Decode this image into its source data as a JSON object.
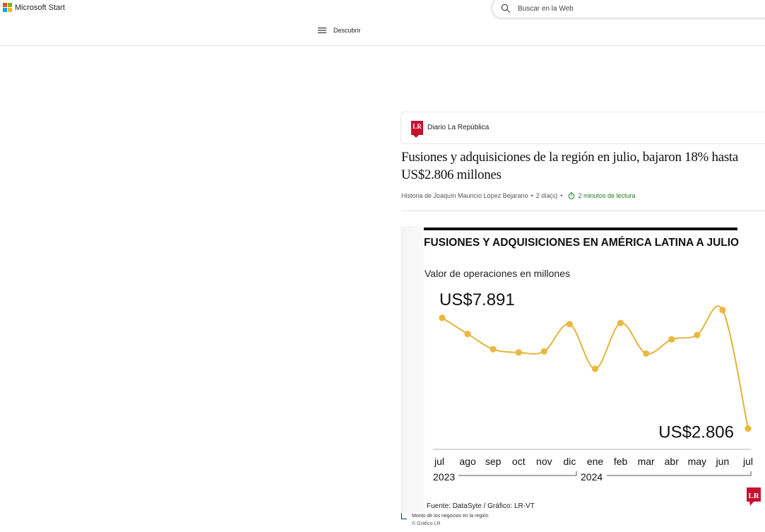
{
  "header": {
    "brand": "Microsoft Start",
    "search_placeholder": "Buscar en la Web",
    "nav_label": "Descubrir"
  },
  "article": {
    "source": "Diario La República",
    "source_logo_text": "LR",
    "title": "Fusiones y adquisiciones de la región en julio, bajaron 18% hasta US$2.806 millones",
    "byline": "Historia de Joaquín Mauricio López Bejarano",
    "age": "2 día(s)",
    "separator": "•",
    "read_time": "2 minutos de lectura",
    "figure_caption": "Monto de los negocios en la región",
    "figure_copyright": "© Gráfico LR"
  },
  "colors": {
    "line": "#e3b33a",
    "point": "#e8b840",
    "brand_red": "#c8102e",
    "read_green": "#1f7a1f"
  },
  "chart_data": {
    "type": "line",
    "title": "FUSIONES Y ADQUISICIONES EN AMÉRICA LATINA A JULIO",
    "subtitle": "Valor de operaciones en millones",
    "categories": [
      "jul",
      "ago",
      "sep",
      "oct",
      "nov",
      "dic",
      "ene",
      "feb",
      "mar",
      "abr",
      "may",
      "jun",
      "jul"
    ],
    "year_labels": [
      "2023",
      "2024"
    ],
    "values": [
      7891,
      7150,
      6450,
      6300,
      6350,
      7600,
      5550,
      7650,
      6250,
      6900,
      7100,
      8250,
      2806
    ],
    "annotations": [
      {
        "index": 0,
        "text": "US$7.891"
      },
      {
        "index": 12,
        "text": "US$2.806"
      }
    ],
    "source": "Fuente: DataSyte / Gráfico: LR-VT",
    "logo": "LR",
    "ylim": [
      2500,
      8600
    ],
    "grid": false,
    "legend": "none"
  }
}
